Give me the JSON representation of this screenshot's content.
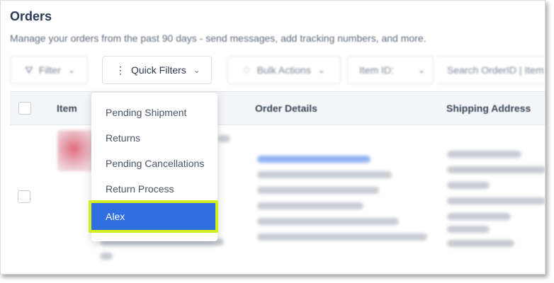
{
  "page": {
    "title": "Orders",
    "subtitle": "Manage your orders from the past 90 days - send messages, add tracking numbers, and more."
  },
  "toolbar": {
    "filter_label": "Filter",
    "quick_filters_label": "Quick Filters",
    "bulk_actions_label": "Bulk Actions",
    "item_id_label": "Item ID:",
    "search_placeholder": "Search OrderID | Item"
  },
  "table": {
    "columns": [
      "Item",
      "Order Details",
      "Shipping Address"
    ]
  },
  "quick_filters_menu": {
    "items": [
      "Pending Shipment",
      "Returns",
      "Pending Cancellations",
      "Return Process"
    ],
    "selected": "Alex"
  },
  "colors": {
    "accent": "#2f6fe0",
    "highlight_border": "#d6ef1e",
    "title": "#2b3a55"
  }
}
